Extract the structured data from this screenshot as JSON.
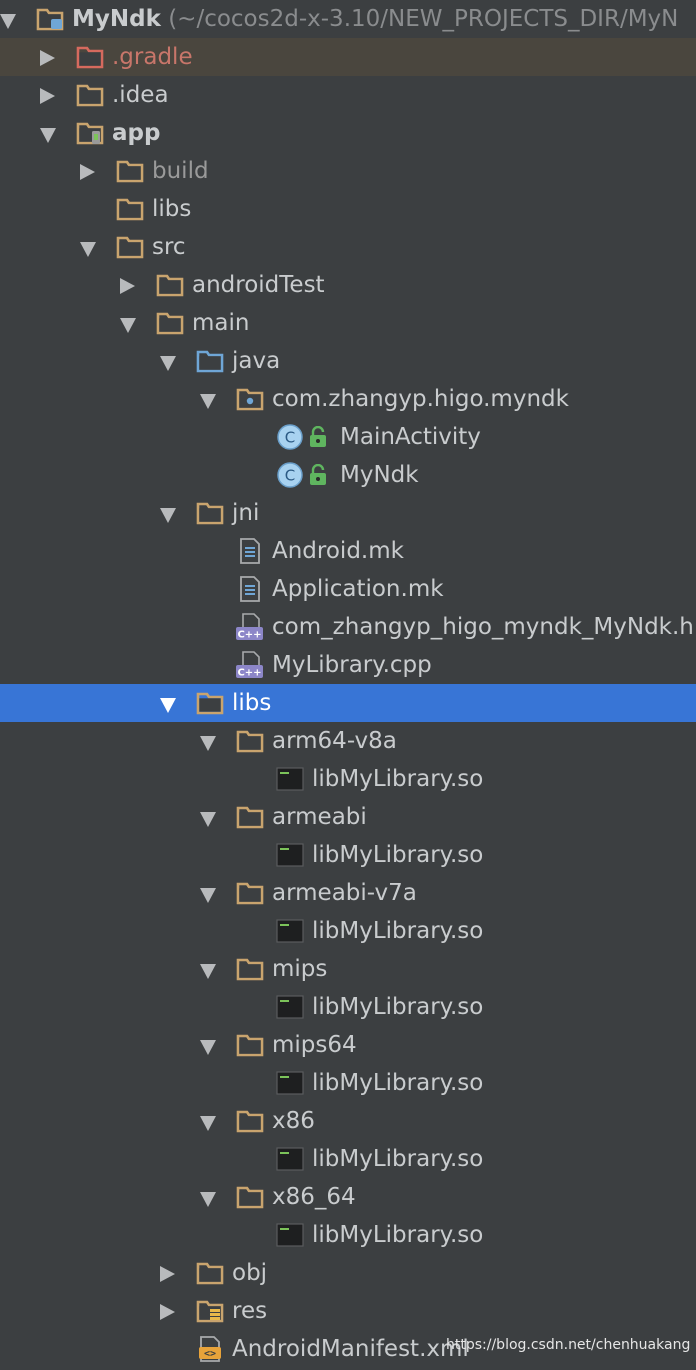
{
  "project": {
    "name": "MyNdk",
    "path": "(~/cocos2d-x-3.10/NEW_PROJECTS_DIR/MyN"
  },
  "nodes": [
    {
      "label": "MyNdk",
      "icon": "module-folder-icon",
      "arrow": "expanded",
      "level": 0
    },
    {
      "label": ".gradle",
      "icon": "folder-excluded-icon",
      "arrow": "collapsed",
      "level": 1
    },
    {
      "label": ".idea",
      "icon": "folder-icon",
      "arrow": "collapsed",
      "level": 1
    },
    {
      "label": "app",
      "icon": "android-module-icon",
      "arrow": "expanded",
      "level": 1
    },
    {
      "label": "build",
      "icon": "folder-icon",
      "arrow": "collapsed",
      "level": 2
    },
    {
      "label": "libs",
      "icon": "folder-icon",
      "arrow": "none",
      "level": 2
    },
    {
      "label": "src",
      "icon": "folder-icon",
      "arrow": "expanded",
      "level": 2
    },
    {
      "label": "androidTest",
      "icon": "folder-icon",
      "arrow": "collapsed",
      "level": 3
    },
    {
      "label": "main",
      "icon": "folder-icon",
      "arrow": "expanded",
      "level": 3
    },
    {
      "label": "java",
      "icon": "source-folder-icon",
      "arrow": "expanded",
      "level": 4
    },
    {
      "label": "com.zhangyp.higo.myndk",
      "icon": "package-icon",
      "arrow": "expanded",
      "level": 5
    },
    {
      "label": "MainActivity",
      "icon": "java-class-icon",
      "arrow": "none",
      "level": 6
    },
    {
      "label": "MyNdk",
      "icon": "java-class-icon",
      "arrow": "none",
      "level": 6
    },
    {
      "label": "jni",
      "icon": "folder-icon",
      "arrow": "expanded",
      "level": 4
    },
    {
      "label": "Android.mk",
      "icon": "text-file-icon",
      "arrow": "none",
      "level": 5
    },
    {
      "label": "Application.mk",
      "icon": "text-file-icon",
      "arrow": "none",
      "level": 5
    },
    {
      "label": "com_zhangyp_higo_myndk_MyNdk.h",
      "icon": "cpp-file-icon",
      "arrow": "none",
      "level": 5
    },
    {
      "label": "MyLibrary.cpp",
      "icon": "cpp-file-icon",
      "arrow": "none",
      "level": 5
    },
    {
      "label": "libs",
      "icon": "folder-icon",
      "arrow": "expanded",
      "level": 4,
      "selected": true
    },
    {
      "label": "arm64-v8a",
      "icon": "folder-icon",
      "arrow": "expanded",
      "level": 5
    },
    {
      "label": "libMyLibrary.so",
      "icon": "binary-file-icon",
      "arrow": "none",
      "level": 6
    },
    {
      "label": "armeabi",
      "icon": "folder-icon",
      "arrow": "expanded",
      "level": 5
    },
    {
      "label": "libMyLibrary.so",
      "icon": "binary-file-icon",
      "arrow": "none",
      "level": 6
    },
    {
      "label": "armeabi-v7a",
      "icon": "folder-icon",
      "arrow": "expanded",
      "level": 5
    },
    {
      "label": "libMyLibrary.so",
      "icon": "binary-file-icon",
      "arrow": "none",
      "level": 6
    },
    {
      "label": "mips",
      "icon": "folder-icon",
      "arrow": "expanded",
      "level": 5
    },
    {
      "label": "libMyLibrary.so",
      "icon": "binary-file-icon",
      "arrow": "none",
      "level": 6
    },
    {
      "label": "mips64",
      "icon": "folder-icon",
      "arrow": "expanded",
      "level": 5
    },
    {
      "label": "libMyLibrary.so",
      "icon": "binary-file-icon",
      "arrow": "none",
      "level": 6
    },
    {
      "label": "x86",
      "icon": "folder-icon",
      "arrow": "expanded",
      "level": 5
    },
    {
      "label": "libMyLibrary.so",
      "icon": "binary-file-icon",
      "arrow": "none",
      "level": 6
    },
    {
      "label": "x86_64",
      "icon": "folder-icon",
      "arrow": "expanded",
      "level": 5
    },
    {
      "label": "libMyLibrary.so",
      "icon": "binary-file-icon",
      "arrow": "none",
      "level": 6
    },
    {
      "label": "obj",
      "icon": "folder-icon",
      "arrow": "collapsed",
      "level": 4
    },
    {
      "label": "res",
      "icon": "resource-folder-icon",
      "arrow": "collapsed",
      "level": 4
    },
    {
      "label": "AndroidManifest.xml",
      "icon": "xml-file-icon",
      "arrow": "none",
      "level": 4
    }
  ],
  "watermark": "https://blog.csdn.net/chenhuakang",
  "colors": {
    "background": "#3c3f41",
    "selection": "#3875d6",
    "folder": "#c9a46e",
    "excluded_folder": "#d66a5e",
    "source_folder": "#6fa6d6",
    "class_badge": "#a8d2f0",
    "lock_badge": "#5fb55f",
    "text": "#c9ccce"
  }
}
